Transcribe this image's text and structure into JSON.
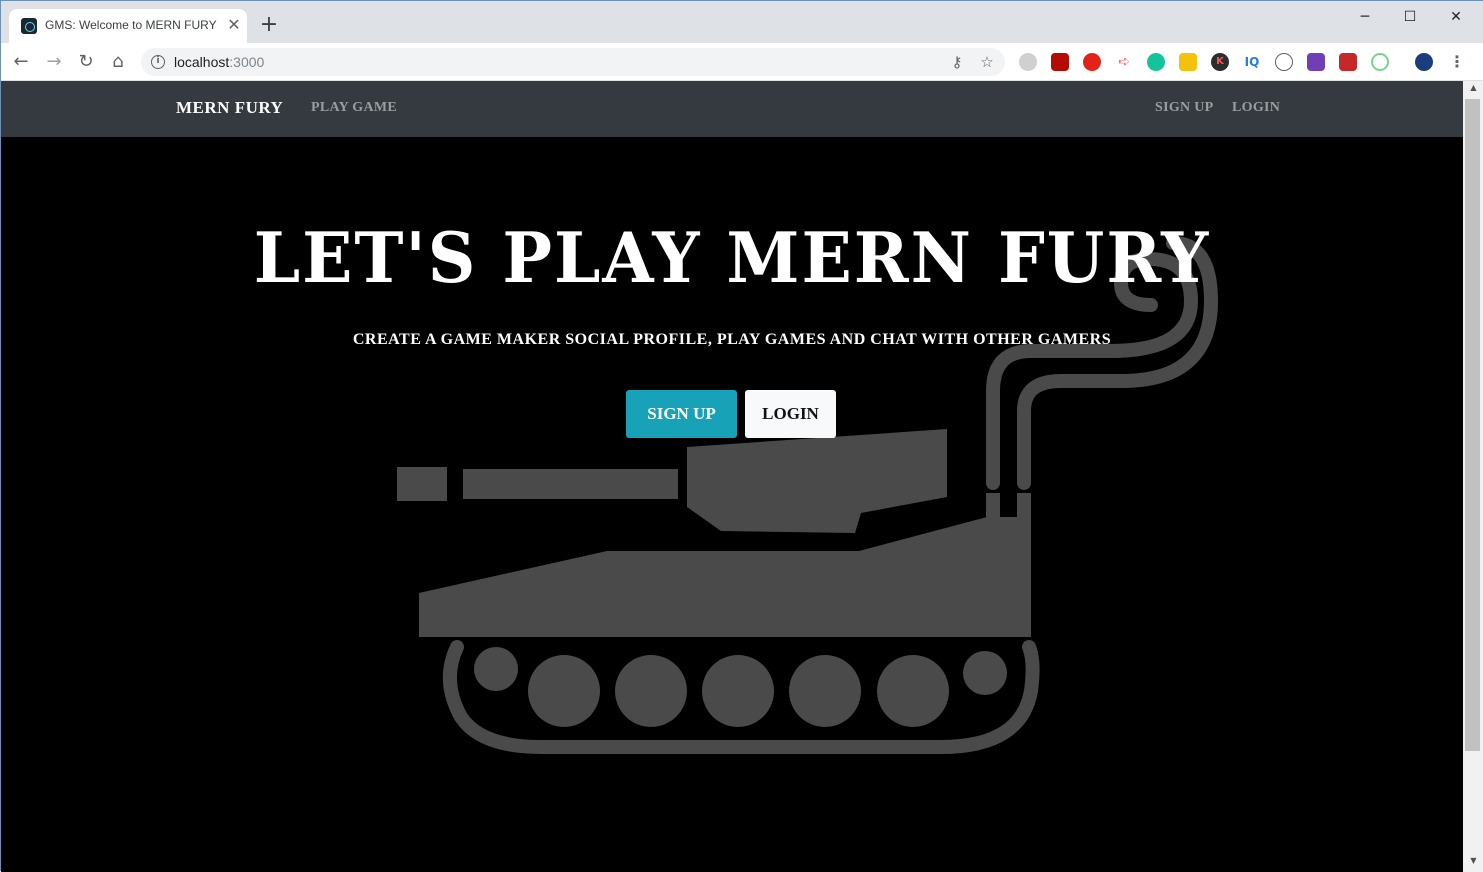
{
  "browser": {
    "tab_title": "GMS: Welcome to MERN FURY",
    "tab_close": "✕",
    "new_tab": "+",
    "url_host": "localhost",
    "url_port": ":3000",
    "window_controls": {
      "minimize": "─",
      "maximize": "☐",
      "close": "✕"
    },
    "extensions": [
      "circle-ext-icon",
      "pdf-ext-icon",
      "red-ext-icon",
      "arrow-ext-icon",
      "grammarly-icon",
      "yellow-ext-icon",
      "k-ext-icon",
      "iq-ext-icon",
      "circle-dots-icon",
      "purple-ext-icon",
      "red-square-icon",
      "green-ring-icon",
      "avatar-icon"
    ],
    "ext_labels": {
      "k": "K",
      "iq": "IQ"
    }
  },
  "site": {
    "brand": "MERN FURY",
    "nav_left": [
      "PLAY GAME"
    ],
    "nav_right": [
      "SIGN UP",
      "LOGIN"
    ]
  },
  "hero": {
    "title": "LET'S PLAY MERN FURY",
    "subtitle": "CREATE A GAME MAKER SOCIAL PROFILE, PLAY GAMES AND CHAT WITH OTHER GAMERS",
    "signup_button": "SIGN UP",
    "login_button": "LOGIN"
  },
  "colors": {
    "navbar": "#343a40",
    "accent": "#17a2b8",
    "background": "#000000",
    "tank": "#4a4a4a"
  }
}
